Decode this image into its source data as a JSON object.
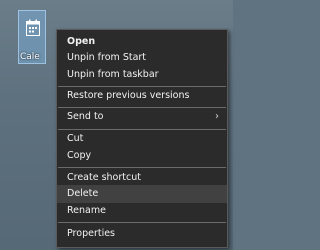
{
  "desktop": {
    "icon": {
      "name": "calendar-icon",
      "label": "Cale"
    }
  },
  "context_menu": {
    "items": [
      {
        "label": "Open",
        "bold": true
      },
      {
        "label": "Unpin from Start"
      },
      {
        "label": "Unpin from taskbar"
      },
      {
        "label": "Restore previous versions"
      },
      {
        "label": "Send to",
        "submenu": true,
        "arrow": "›"
      },
      {
        "label": "Cut"
      },
      {
        "label": "Copy"
      },
      {
        "label": "Create shortcut"
      },
      {
        "label": "Delete",
        "highlighted": true
      },
      {
        "label": "Rename"
      },
      {
        "label": "Properties"
      }
    ]
  }
}
